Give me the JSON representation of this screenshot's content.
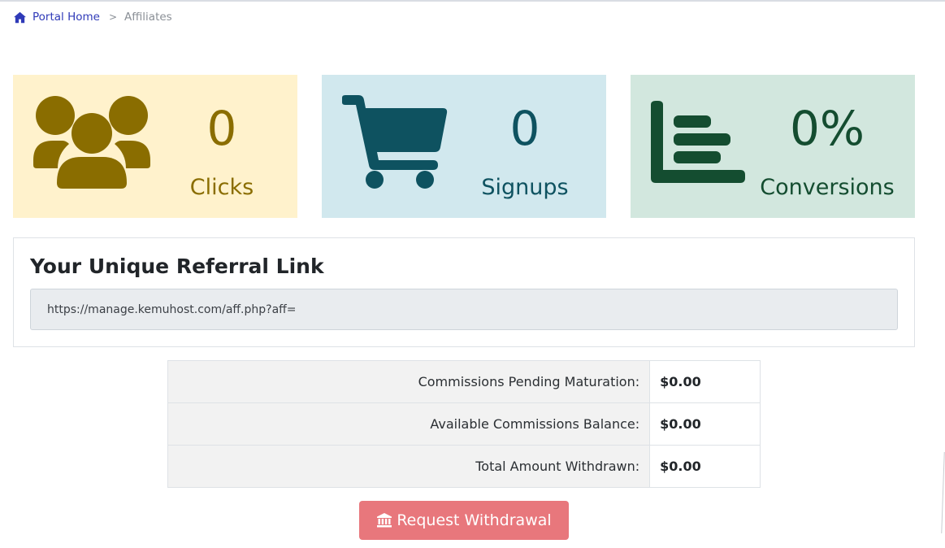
{
  "breadcrumb": {
    "home_label": "Portal Home",
    "separator": ">",
    "current_label": "Affiliates"
  },
  "stats": {
    "clicks": {
      "value": "0",
      "label": "Clicks",
      "icon": "users-icon",
      "color": "#8a6d00",
      "bg": "#fff2cc"
    },
    "signups": {
      "value": "0",
      "label": "Signups",
      "icon": "cart-icon",
      "color": "#0e5260",
      "bg": "#d1e8ee"
    },
    "conversions": {
      "value": "0%",
      "label": "Conversions",
      "icon": "bar-chart-icon",
      "color": "#144d30",
      "bg": "#d2e7de"
    }
  },
  "referral": {
    "title": "Your Unique Referral Link",
    "link_value": "https://manage.kemuhost.com/aff.php?aff="
  },
  "commissions": {
    "rows": [
      {
        "label": "Commissions Pending Maturation:",
        "value": "$0.00"
      },
      {
        "label": "Available Commissions Balance:",
        "value": "$0.00"
      },
      {
        "label": "Total Amount Withdrawn:",
        "value": "$0.00"
      }
    ]
  },
  "withdraw": {
    "label": "Request Withdrawal",
    "icon": "bank-icon",
    "color": "#e8777c"
  }
}
